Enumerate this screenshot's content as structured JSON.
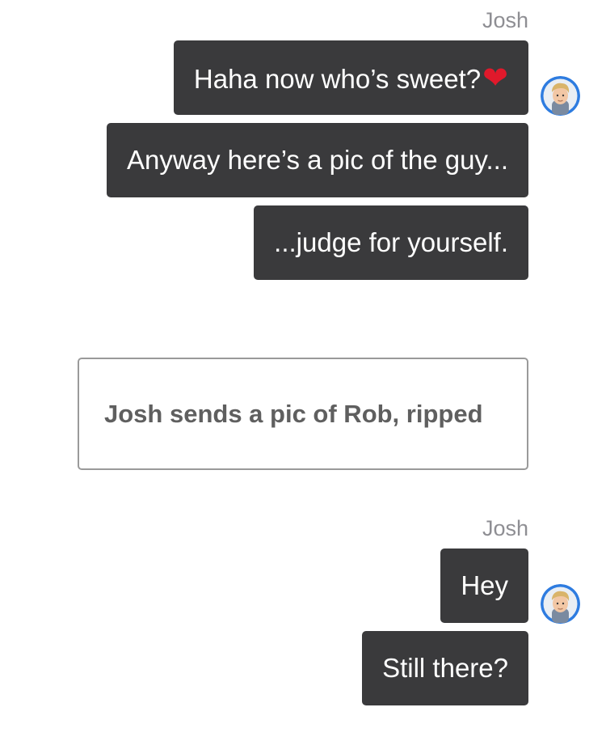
{
  "conversation": [
    {
      "type": "message-group",
      "sender": "Josh",
      "avatar_icon": "josh-avatar",
      "messages": [
        {
          "text": "Haha now who’s sweet?",
          "emoji": "❤"
        },
        {
          "text": "Anyway here’s a pic of the guy..."
        },
        {
          "text": "...judge for yourself."
        }
      ]
    },
    {
      "type": "narration",
      "text": "Josh sends a pic of Rob, ripped"
    },
    {
      "type": "message-group",
      "sender": "Josh",
      "avatar_icon": "josh-avatar",
      "messages": [
        {
          "text": "Hey"
        },
        {
          "text": "Still there?"
        }
      ]
    }
  ],
  "colors": {
    "bubble_background": "#3a3a3c",
    "bubble_text": "#ffffff",
    "sender_name": "#8e8e93",
    "narration_border": "#9a9a9a",
    "narration_text": "#5f5f5f",
    "avatar_ring": "#2e7ce0"
  }
}
